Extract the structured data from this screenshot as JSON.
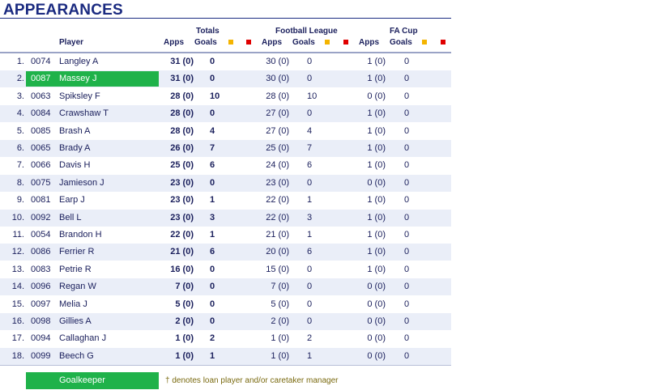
{
  "title": "APPEARANCES",
  "headers": {
    "player": "Player",
    "totals": "Totals",
    "football_league": "Football League",
    "fa_cup": "FA Cup",
    "apps": "Apps",
    "goals": "Goals"
  },
  "colors": {
    "goalkeeper": "#1fb24a",
    "yellow_card": "#f4b400",
    "red_card": "#e00000",
    "alt_row": "#eaeef8"
  },
  "players": [
    {
      "pos": "1.",
      "code": "0074",
      "name": "Langley A",
      "total_apps": "31 (0)",
      "total_goals": "0",
      "fl_apps": "30 (0)",
      "fl_goals": "0",
      "fa_apps": "1 (0)",
      "fa_goals": "0",
      "goalkeeper": false
    },
    {
      "pos": "2.",
      "code": "0087",
      "name": "Massey J",
      "total_apps": "31 (0)",
      "total_goals": "0",
      "fl_apps": "30 (0)",
      "fl_goals": "0",
      "fa_apps": "1 (0)",
      "fa_goals": "0",
      "goalkeeper": true
    },
    {
      "pos": "3.",
      "code": "0063",
      "name": "Spiksley F",
      "total_apps": "28 (0)",
      "total_goals": "10",
      "fl_apps": "28 (0)",
      "fl_goals": "10",
      "fa_apps": "0 (0)",
      "fa_goals": "0",
      "goalkeeper": false
    },
    {
      "pos": "4.",
      "code": "0084",
      "name": "Crawshaw T",
      "total_apps": "28 (0)",
      "total_goals": "0",
      "fl_apps": "27 (0)",
      "fl_goals": "0",
      "fa_apps": "1 (0)",
      "fa_goals": "0",
      "goalkeeper": false
    },
    {
      "pos": "5.",
      "code": "0085",
      "name": "Brash A",
      "total_apps": "28 (0)",
      "total_goals": "4",
      "fl_apps": "27 (0)",
      "fl_goals": "4",
      "fa_apps": "1 (0)",
      "fa_goals": "0",
      "goalkeeper": false
    },
    {
      "pos": "6.",
      "code": "0065",
      "name": "Brady A",
      "total_apps": "26 (0)",
      "total_goals": "7",
      "fl_apps": "25 (0)",
      "fl_goals": "7",
      "fa_apps": "1 (0)",
      "fa_goals": "0",
      "goalkeeper": false
    },
    {
      "pos": "7.",
      "code": "0066",
      "name": "Davis H",
      "total_apps": "25 (0)",
      "total_goals": "6",
      "fl_apps": "24 (0)",
      "fl_goals": "6",
      "fa_apps": "1 (0)",
      "fa_goals": "0",
      "goalkeeper": false
    },
    {
      "pos": "8.",
      "code": "0075",
      "name": "Jamieson J",
      "total_apps": "23 (0)",
      "total_goals": "0",
      "fl_apps": "23 (0)",
      "fl_goals": "0",
      "fa_apps": "0 (0)",
      "fa_goals": "0",
      "goalkeeper": false
    },
    {
      "pos": "9.",
      "code": "0081",
      "name": "Earp J",
      "total_apps": "23 (0)",
      "total_goals": "1",
      "fl_apps": "22 (0)",
      "fl_goals": "1",
      "fa_apps": "1 (0)",
      "fa_goals": "0",
      "goalkeeper": false
    },
    {
      "pos": "10.",
      "code": "0092",
      "name": "Bell L",
      "total_apps": "23 (0)",
      "total_goals": "3",
      "fl_apps": "22 (0)",
      "fl_goals": "3",
      "fa_apps": "1 (0)",
      "fa_goals": "0",
      "goalkeeper": false
    },
    {
      "pos": "11.",
      "code": "0054",
      "name": "Brandon H",
      "total_apps": "22 (0)",
      "total_goals": "1",
      "fl_apps": "21 (0)",
      "fl_goals": "1",
      "fa_apps": "1 (0)",
      "fa_goals": "0",
      "goalkeeper": false
    },
    {
      "pos": "12.",
      "code": "0086",
      "name": "Ferrier R",
      "total_apps": "21 (0)",
      "total_goals": "6",
      "fl_apps": "20 (0)",
      "fl_goals": "6",
      "fa_apps": "1 (0)",
      "fa_goals": "0",
      "goalkeeper": false
    },
    {
      "pos": "13.",
      "code": "0083",
      "name": "Petrie R",
      "total_apps": "16 (0)",
      "total_goals": "0",
      "fl_apps": "15 (0)",
      "fl_goals": "0",
      "fa_apps": "1 (0)",
      "fa_goals": "0",
      "goalkeeper": false
    },
    {
      "pos": "14.",
      "code": "0096",
      "name": "Regan W",
      "total_apps": "7 (0)",
      "total_goals": "0",
      "fl_apps": "7 (0)",
      "fl_goals": "0",
      "fa_apps": "0 (0)",
      "fa_goals": "0",
      "goalkeeper": false
    },
    {
      "pos": "15.",
      "code": "0097",
      "name": "Melia J",
      "total_apps": "5 (0)",
      "total_goals": "0",
      "fl_apps": "5 (0)",
      "fl_goals": "0",
      "fa_apps": "0 (0)",
      "fa_goals": "0",
      "goalkeeper": false
    },
    {
      "pos": "16.",
      "code": "0098",
      "name": "Gillies A",
      "total_apps": "2 (0)",
      "total_goals": "0",
      "fl_apps": "2 (0)",
      "fl_goals": "0",
      "fa_apps": "0 (0)",
      "fa_goals": "0",
      "goalkeeper": false
    },
    {
      "pos": "17.",
      "code": "0094",
      "name": "Callaghan J",
      "total_apps": "1 (0)",
      "total_goals": "2",
      "fl_apps": "1 (0)",
      "fl_goals": "2",
      "fa_apps": "0 (0)",
      "fa_goals": "0",
      "goalkeeper": false
    },
    {
      "pos": "18.",
      "code": "0099",
      "name": "Beech G",
      "total_apps": "1 (0)",
      "total_goals": "1",
      "fl_apps": "1 (0)",
      "fl_goals": "1",
      "fa_apps": "0 (0)",
      "fa_goals": "0",
      "goalkeeper": false
    }
  ],
  "legend": {
    "goalkeeper_label": "Goalkeeper",
    "note": "† denotes loan player and/or caretaker manager"
  }
}
